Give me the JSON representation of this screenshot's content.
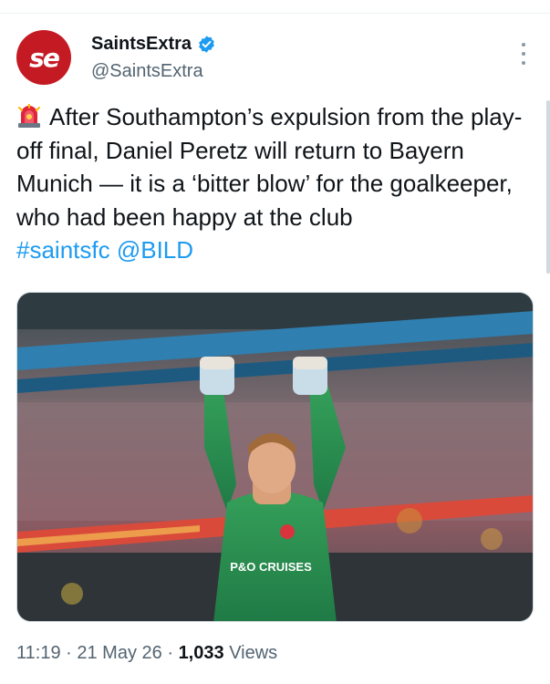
{
  "author": {
    "avatar_text": "se",
    "display_name": "SaintsExtra",
    "handle": "@SaintsExtra"
  },
  "tweet": {
    "emoji": "siren-icon",
    "text": "After Southampton’s expulsion from the play-off final, Daniel Peretz will return to Bayern Munich — it is a ‘bitter blow’ for the goalkeeper, who had been happy at the club",
    "hashtag": "#saintsfc",
    "mention": "@BILD"
  },
  "media": {
    "shirt_sponsor": "P&O CRUISES"
  },
  "meta": {
    "time": "11:19",
    "separator": "·",
    "date": "21 May 26",
    "views_count": "1,033",
    "views_label": "Views"
  },
  "colors": {
    "brand": "#c41a24",
    "link": "#1d9bf0",
    "verified": "#1d9bf0",
    "secondary_text": "#536471"
  }
}
